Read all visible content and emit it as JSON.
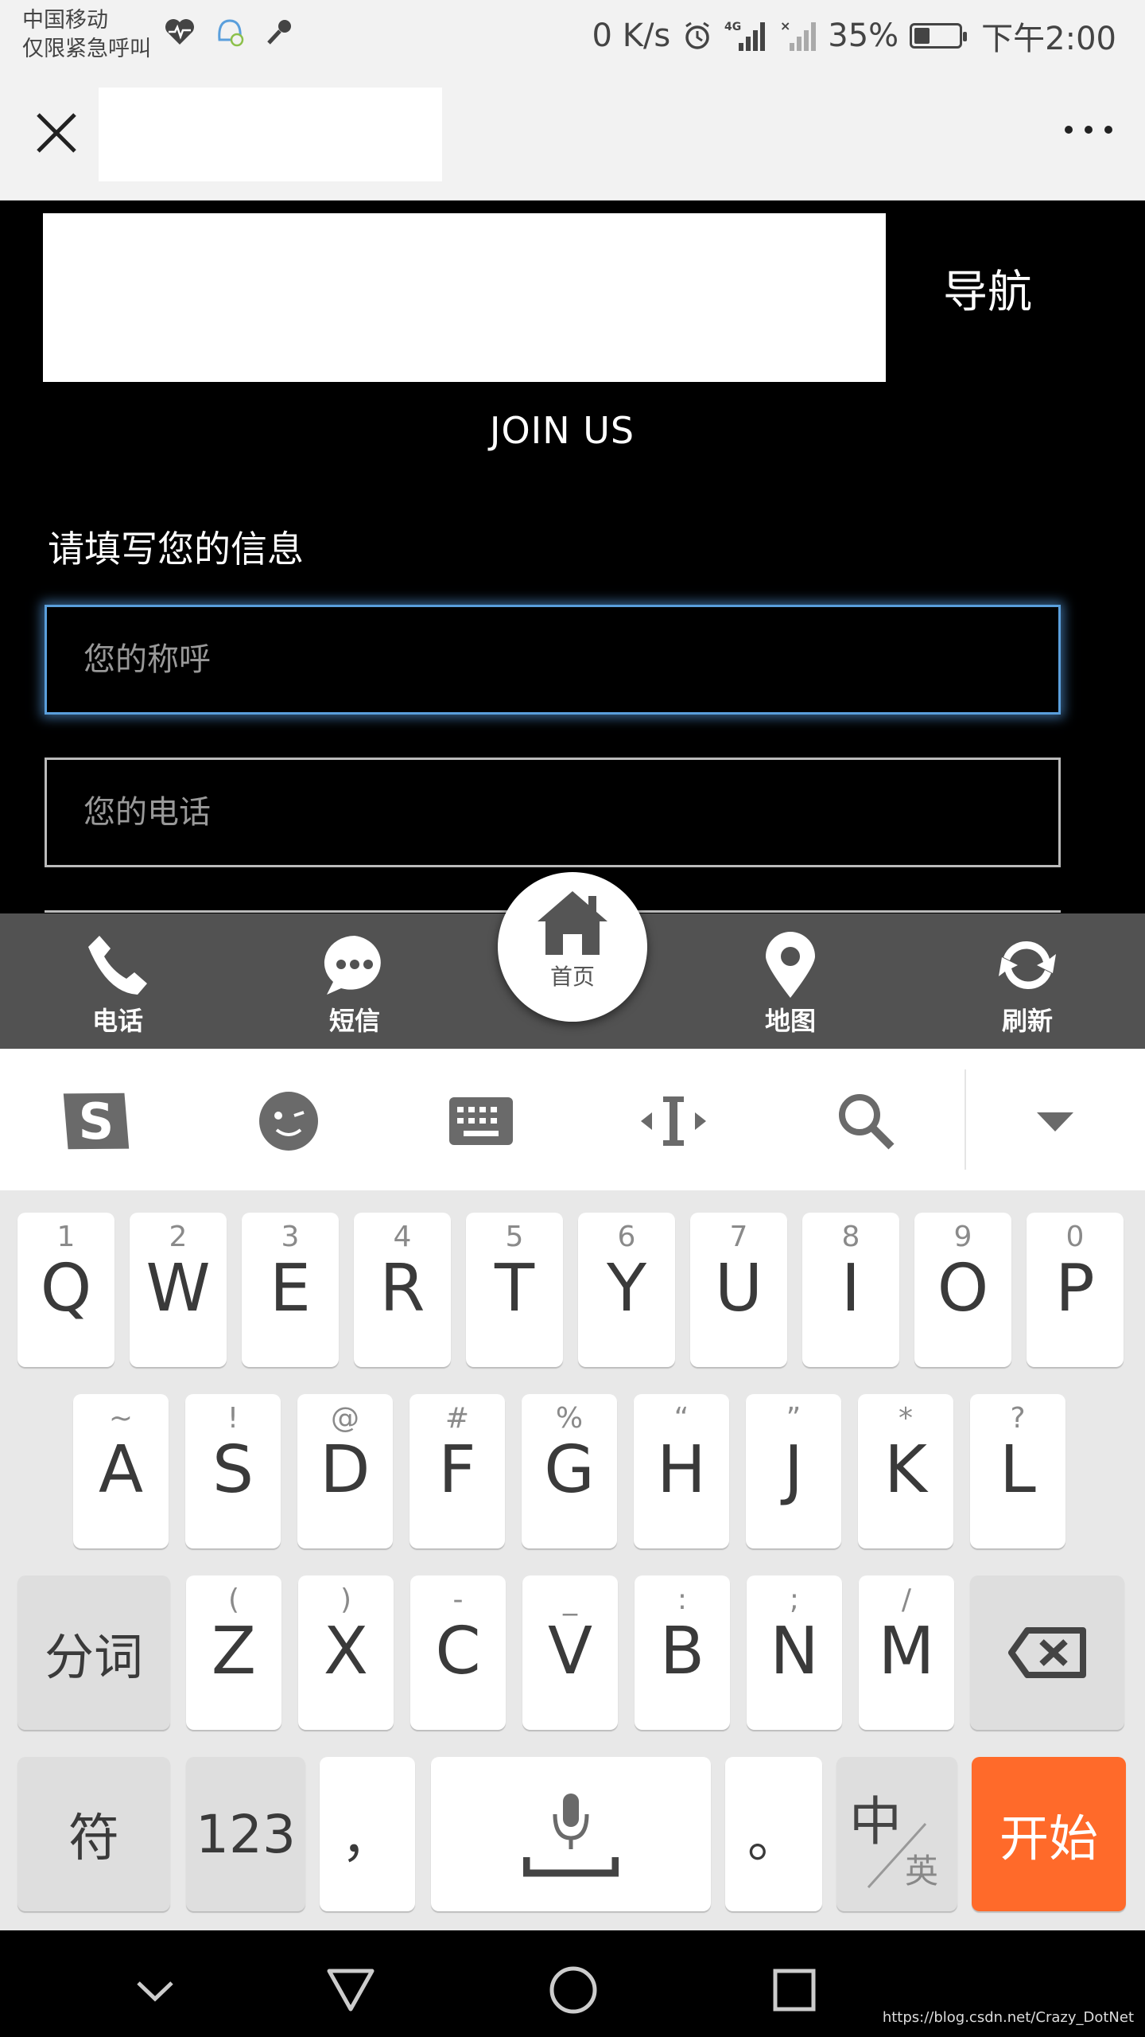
{
  "status_bar": {
    "carrier_line1": "中国移动",
    "carrier_line2": "仅限紧急呼叫",
    "net_speed": "0 K/s",
    "network": "4G",
    "battery": "35%",
    "battery_level": 0.35,
    "time": "下午2:00"
  },
  "header": {
    "nav_label": "导航",
    "join_label": "JOIN US",
    "form_title": "请填写您的信息"
  },
  "form": {
    "name_placeholder": "您的称呼",
    "phone_placeholder": "您的电话"
  },
  "bottom_nav": {
    "phone": "电话",
    "sms": "短信",
    "home": "首页",
    "map": "地图",
    "refresh": "刷新"
  },
  "keyboard": {
    "row1": [
      {
        "sub": "1",
        "main": "Q"
      },
      {
        "sub": "2",
        "main": "W"
      },
      {
        "sub": "3",
        "main": "E"
      },
      {
        "sub": "4",
        "main": "R"
      },
      {
        "sub": "5",
        "main": "T"
      },
      {
        "sub": "6",
        "main": "Y"
      },
      {
        "sub": "7",
        "main": "U"
      },
      {
        "sub": "8",
        "main": "I"
      },
      {
        "sub": "9",
        "main": "O"
      },
      {
        "sub": "0",
        "main": "P"
      }
    ],
    "row2": [
      {
        "sub": "~",
        "main": "A"
      },
      {
        "sub": "!",
        "main": "S"
      },
      {
        "sub": "@",
        "main": "D"
      },
      {
        "sub": "#",
        "main": "F"
      },
      {
        "sub": "%",
        "main": "G"
      },
      {
        "sub": "“",
        "main": "H"
      },
      {
        "sub": "”",
        "main": "J"
      },
      {
        "sub": "*",
        "main": "K"
      },
      {
        "sub": "?",
        "main": "L"
      }
    ],
    "row3": [
      {
        "sub": "(",
        "main": "Z"
      },
      {
        "sub": ")",
        "main": "X"
      },
      {
        "sub": "-",
        "main": "C"
      },
      {
        "sub": "_",
        "main": "V"
      },
      {
        "sub": ":",
        "main": "B"
      },
      {
        "sub": ";",
        "main": "N"
      },
      {
        "sub": "/",
        "main": "M"
      }
    ],
    "segment_key": "分词",
    "symbol_key": "符",
    "num_key": "123",
    "comma_key": "，",
    "period_key": "。",
    "lang_key_zh": "中",
    "lang_key_en": "英",
    "go_key": "开始"
  },
  "watermark": "https://blog.csdn.net/Crazy_DotNet"
}
